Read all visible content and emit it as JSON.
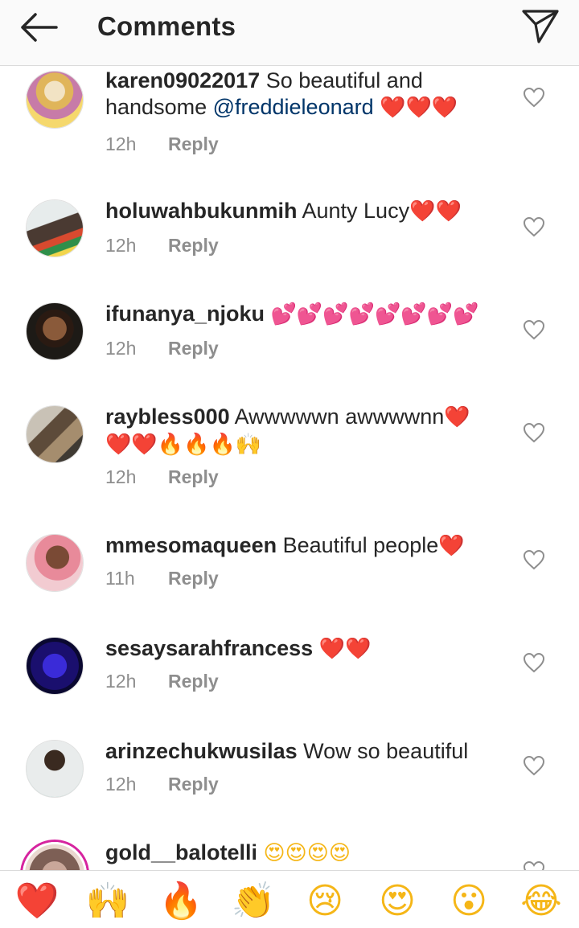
{
  "header": {
    "title": "Comments",
    "back_icon": "arrow-left-icon",
    "share_icon": "paper-plane-icon"
  },
  "comments": [
    {
      "username": "karen09022017",
      "text": "So beautiful and handsome ",
      "mention": "@freddieleonard",
      "emojis": "❤️❤️❤️",
      "time": "12h",
      "reply": "Reply"
    },
    {
      "username": "holuwahbukunmih",
      "text": "Aunty Lucy",
      "emojis": "❤️❤️",
      "time": "12h",
      "reply": "Reply"
    },
    {
      "username": "ifunanya_njoku",
      "text": "",
      "emojis": "💕💕💕💕💕💕💕💕",
      "time": "12h",
      "reply": "Reply"
    },
    {
      "username": "raybless000",
      "text": "Awwwwwn awwwwnn",
      "emojis": "❤️❤️❤️🔥🔥🔥🙌",
      "time": "12h",
      "reply": "Reply"
    },
    {
      "username": "mmesomaqueen",
      "text": "Beautiful people",
      "emojis": "❤️",
      "time": "11h",
      "reply": "Reply"
    },
    {
      "username": "sesaysarahfrancess",
      "text": "",
      "emojis": "❤️❤️",
      "time": "12h",
      "reply": "Reply"
    },
    {
      "username": "arinzechukwusilas",
      "text": "Wow so beautiful",
      "emojis": "",
      "time": "12h",
      "reply": "Reply"
    },
    {
      "username": "gold__balotelli",
      "text": "",
      "emojis": "😍😍😍😍",
      "time": "",
      "reply": ""
    }
  ],
  "emoji_bar": [
    "❤️",
    "🙌",
    "🔥",
    "👏",
    "😢",
    "😍",
    "😮",
    "😂"
  ],
  "colors": {
    "heart": "#ed1c24",
    "mention": "#003569",
    "meta": "#8e8e8e",
    "text": "#262626"
  }
}
